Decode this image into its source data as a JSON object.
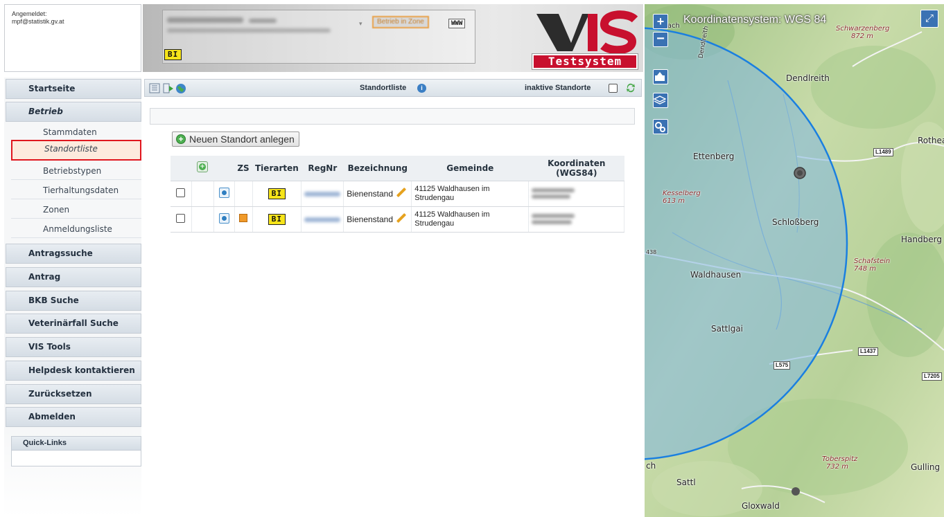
{
  "login": {
    "label": "Angemeldet:",
    "email": "mpf@statistik.gv.at"
  },
  "header": {
    "zone_button": "Betrieb in Zone",
    "www_button": "WWW",
    "species_badge": "BI",
    "logo_text_dark": "V",
    "logo_text_red": "IS",
    "badge": "Testsystem"
  },
  "sidebar": {
    "items": [
      {
        "label": "Startseite",
        "type": "head"
      },
      {
        "label": "Betrieb",
        "type": "head",
        "italic": true
      },
      {
        "label": "Stammdaten",
        "type": "sub"
      },
      {
        "label": "Standortliste",
        "type": "sub",
        "active": true
      },
      {
        "label": "Betriebstypen",
        "type": "sub"
      },
      {
        "label": "Tierhaltungsdaten",
        "type": "sub"
      },
      {
        "label": "Zonen",
        "type": "sub"
      },
      {
        "label": "Anmeldungsliste",
        "type": "sub"
      },
      {
        "label": "Antragssuche",
        "type": "head"
      },
      {
        "label": "Antrag",
        "type": "head"
      },
      {
        "label": "BKB Suche",
        "type": "head"
      },
      {
        "label": "Veterinärfall Suche",
        "type": "head"
      },
      {
        "label": "VIS Tools",
        "type": "head"
      },
      {
        "label": "Helpdesk kontaktieren",
        "type": "head"
      },
      {
        "label": "Zurücksetzen",
        "type": "head"
      },
      {
        "label": "Abmelden",
        "type": "head"
      }
    ],
    "quick_links": "Quick-Links"
  },
  "toolbar": {
    "title": "Standortliste",
    "inactive_label": "inaktive Standorte",
    "inactive_checked": false
  },
  "main": {
    "new_button": "Neuen Standort anlegen",
    "table": {
      "headers": {
        "zs": "ZS",
        "tierarten": "Tierarten",
        "regnr": "RegNr",
        "bezeichnung": "Bezeichnung",
        "gemeinde": "Gemeinde",
        "koordinaten": "Koordinaten (WGS84)"
      },
      "rows": [
        {
          "tierarten": "BI",
          "zs": false,
          "bezeichnung": "Bienenstand",
          "gemeinde": "41125 Waldhausen im Strudengau"
        },
        {
          "tierarten": "BI",
          "zs": true,
          "bezeichnung": "Bienenstand",
          "gemeinde": "41125 Waldhausen im Strudengau"
        }
      ]
    }
  },
  "map": {
    "title": "Koordinatensystem: WGS 84",
    "zoom_in": "+",
    "zoom_out": "−",
    "labels": {
      "dendlreith": "Dendlreith",
      "rothea": "Rothea",
      "ettenberg": "Ettenberg",
      "kesselberg": "Kesselberg",
      "kesselberg_height": "613 m",
      "schlossberg": "Schloßberg",
      "handberg": "Handberg",
      "schafstein": "Schafstein",
      "schafstein_height": "748 m",
      "waldhausen": "Waldhausen",
      "sattlgai": "Sattlgai",
      "schwarzenberg": "Schwarzenberg",
      "schwarzenberg_height": "872 m",
      "toberspitz": "Toberspitz",
      "toberspitz_height": "732 m",
      "gulling": "Gulling",
      "sattl": "Sattl",
      "gloxwald": "Gloxwald",
      "imbach": "imbach",
      "dendlreith_rotated": "Dendlreith",
      "ch": "ch",
      "num_438": "438"
    },
    "roads": [
      "L1489",
      "L1437",
      "L575",
      "L7205"
    ],
    "colors": {
      "circle": "#1a7fe0",
      "fill": "#7fb6e0",
      "terrain": "#c8dba9"
    }
  }
}
